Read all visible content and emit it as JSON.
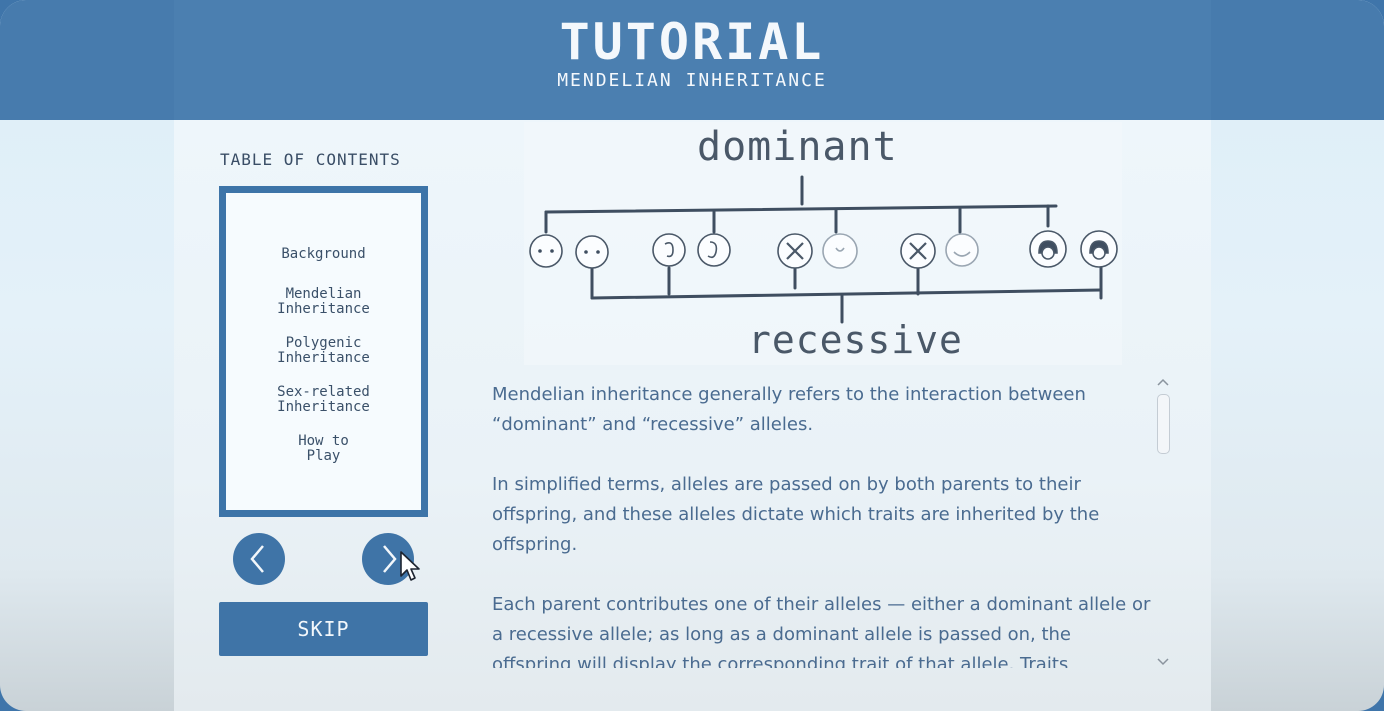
{
  "header": {
    "title": "TUTORIAL",
    "subtitle": "MENDELIAN INHERITANCE"
  },
  "toc": {
    "title": "TABLE OF CONTENTS",
    "items": [
      {
        "line1": "Background",
        "line2": ""
      },
      {
        "line1": "Mendelian",
        "line2": "Inheritance"
      },
      {
        "line1": "Polygenic",
        "line2": "Inheritance"
      },
      {
        "line1": "Sex-related",
        "line2": "Inheritance"
      },
      {
        "line1": "How to",
        "line2": "Play"
      }
    ]
  },
  "nav": {
    "prev_icon": "chevron-left-icon",
    "next_icon": "chevron-right-icon"
  },
  "skip_label": "SKIP",
  "diagram": {
    "top_label": "dominant",
    "bottom_label": "recessive"
  },
  "content": {
    "paragraphs": [
      "Mendelian inheritance generally refers to the interaction between “dominant” and “recessive” alleles.",
      "In simplified terms, alleles are passed on by both parents to their offspring, and these alleles dictate which traits are inherited by the offspring.",
      "Each parent contributes one of their alleles — either a dominant allele or a recessive allele; as long as a dominant allele is passed on, the offspring will display the corresponding trait of that allele. Traits"
    ]
  },
  "colors": {
    "header": "#477bad",
    "accent": "#3f74a7",
    "text": "#4a6b90"
  }
}
